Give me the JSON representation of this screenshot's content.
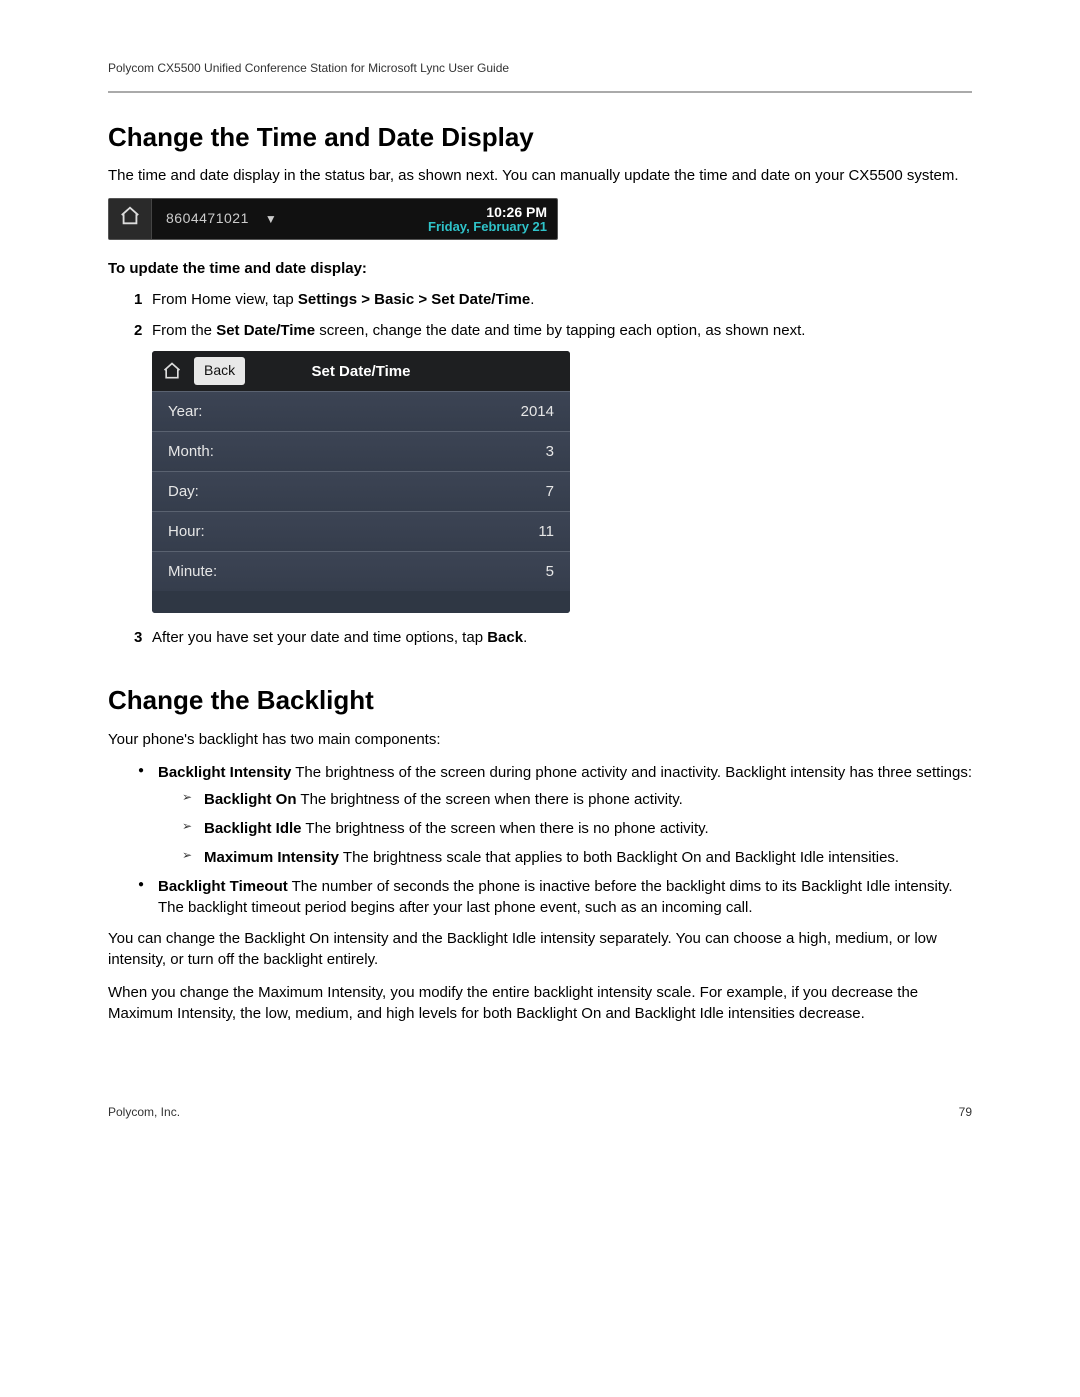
{
  "header": "Polycom CX5500 Unified Conference Station for Microsoft Lync User Guide",
  "h1": "Change the Time and Date Display",
  "intro": "The time and date display in the status bar, as shown next. You can manually update the time and date on your CX5500 system.",
  "statusbar": {
    "phone": "8604471021",
    "time": "10:26 PM",
    "date": "Friday, February 21"
  },
  "subhead": "To update the time and date display:",
  "step1_pre": "From Home view, tap ",
  "step1_bold": "Settings > Basic > Set Date/Time",
  "step2_pre": "From the ",
  "step2_bold": "Set Date/Time",
  "step2_post": " screen, change the date and time by tapping each option, as shown next.",
  "ss2": {
    "back": "Back",
    "title": "Set Date/Time",
    "rows": [
      {
        "label": "Year:",
        "value": "2014"
      },
      {
        "label": "Month:",
        "value": "3"
      },
      {
        "label": "Day:",
        "value": "7"
      },
      {
        "label": "Hour:",
        "value": "11"
      },
      {
        "label": "Minute:",
        "value": "5"
      }
    ]
  },
  "step3_pre": "After you have set your date and time options, tap ",
  "step3_bold": "Back",
  "h2": "Change the Backlight",
  "backlight_intro": "Your phone's backlight has two main components:",
  "b1_bold": "Backlight Intensity",
  "b1_text": "   The brightness of the screen during phone activity and inactivity. Backlight intensity has three settings:",
  "a1_bold": "Backlight On",
  "a1_text": "   The brightness of the screen when there is phone activity.",
  "a2_bold": "Backlight Idle",
  "a2_text": "   The brightness of the screen when there is no phone activity.",
  "a3_bold": "Maximum Intensity",
  "a3_text": "   The brightness scale that applies to both Backlight On and Backlight Idle intensities.",
  "b2_bold": "Backlight Timeout",
  "b2_text": "   The number of seconds the phone is inactive before the backlight dims to its Backlight Idle intensity. The backlight timeout period begins after your last phone event, such as an incoming call.",
  "p1": "You can change the Backlight On intensity and the Backlight Idle intensity separately. You can choose a high, medium, or low intensity, or turn off the backlight entirely.",
  "p2": "When you change the Maximum Intensity, you modify the entire backlight intensity scale. For example, if you decrease the Maximum Intensity, the low, medium, and high levels for both Backlight On and Backlight Idle intensities decrease.",
  "footer_left": "Polycom, Inc.",
  "footer_right": "79"
}
